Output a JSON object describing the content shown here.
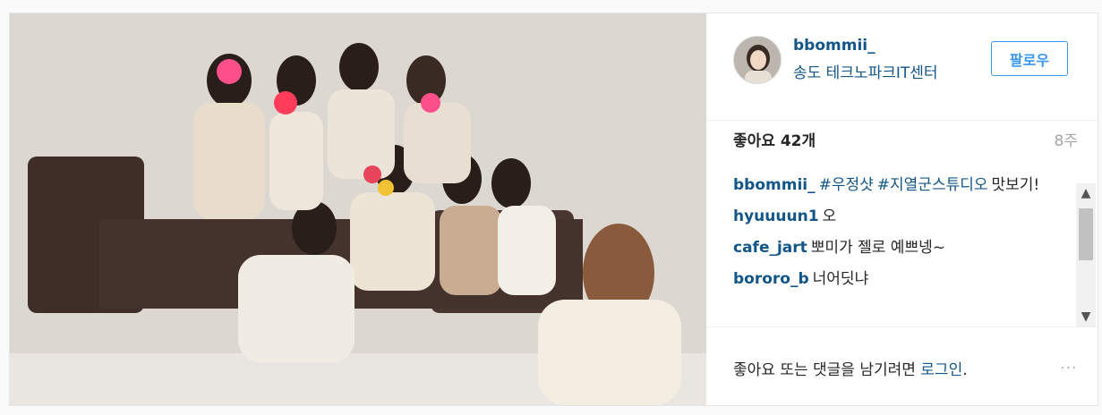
{
  "post": {
    "username": "bbommii_",
    "location": "송도 테크노파크IT센터",
    "follow_label": "팔로우",
    "likes_label": "좋아요 42개",
    "age": "8주"
  },
  "comments": [
    {
      "user": "bbommii_",
      "tags": [
        "#우정샷",
        "#지열군스튜디오"
      ],
      "text": "맛보기!"
    },
    {
      "user": "hyuuuun1",
      "text": "오"
    },
    {
      "user": "cafe_jart",
      "text": "뽀미가 젤로 예쁘넹~"
    },
    {
      "user": "bororo_b",
      "text": "너어딧냐"
    }
  ],
  "footer": {
    "prompt": "좋아요 또는 댓글을 남기려면 ",
    "login": "로그인",
    "period": ".",
    "more_icon": "···"
  },
  "icons": {
    "scroll_up": "chevron-up-icon",
    "scroll_down": "chevron-down-icon",
    "more": "more-options-icon"
  },
  "colors": {
    "link": "#125688",
    "accent": "#3897f0"
  }
}
